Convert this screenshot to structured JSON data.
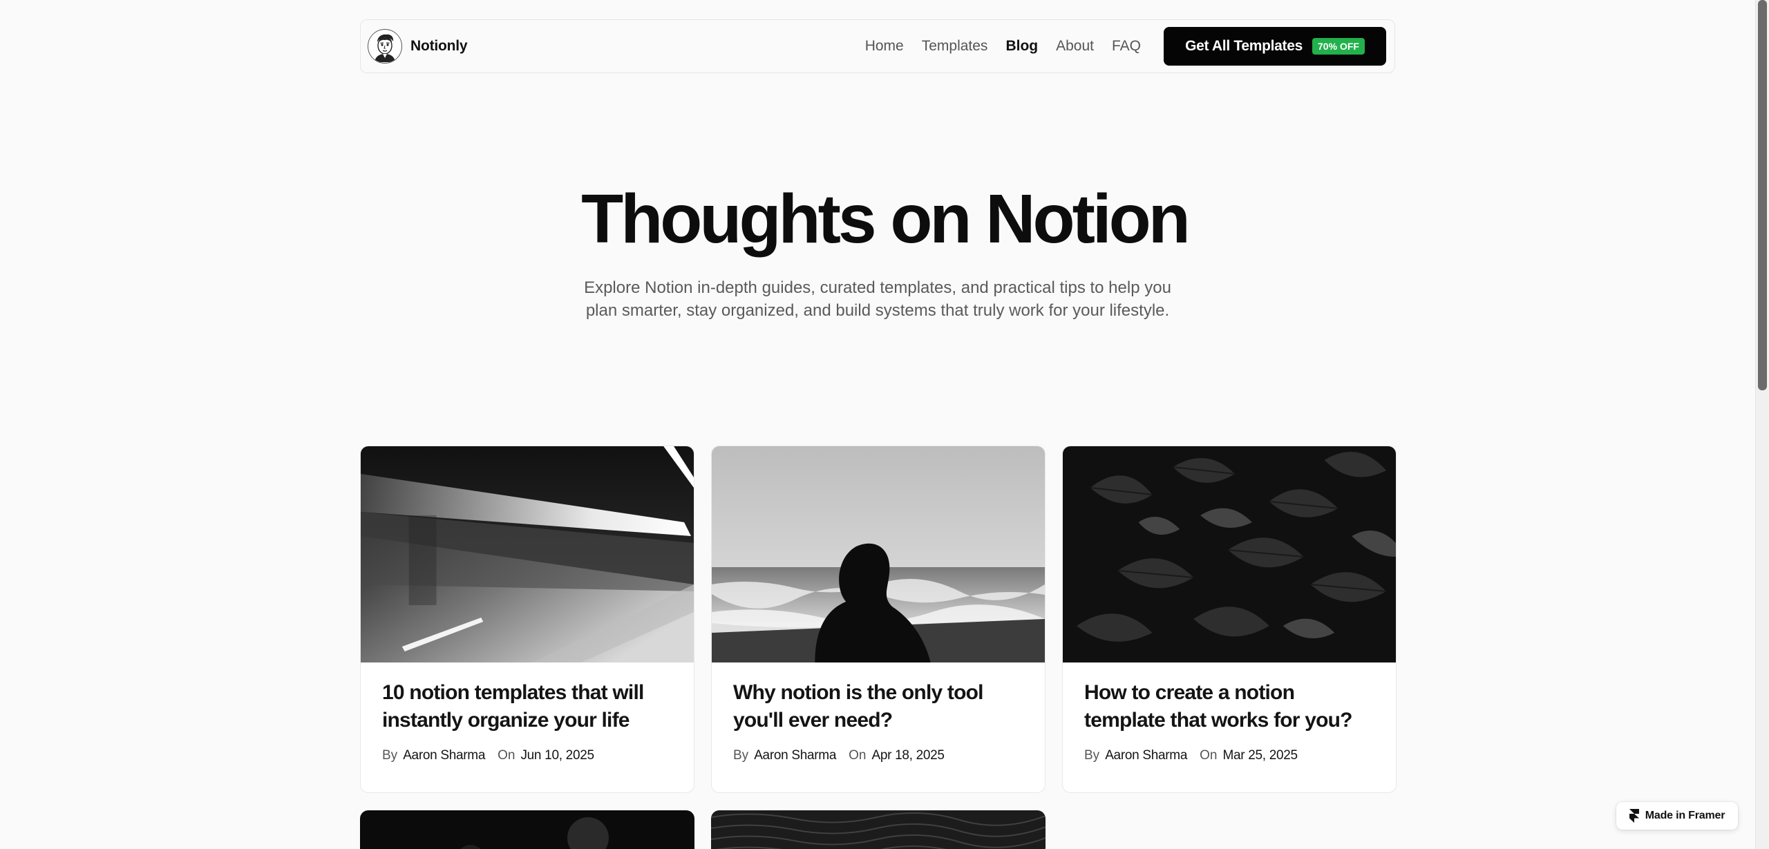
{
  "brand": {
    "name": "Notionly",
    "avatar_icon": "cartoon-face-avatar-icon"
  },
  "nav": {
    "links": [
      {
        "label": "Home",
        "active": false
      },
      {
        "label": "Templates",
        "active": false
      },
      {
        "label": "Blog",
        "active": true
      },
      {
        "label": "About",
        "active": false
      },
      {
        "label": "FAQ",
        "active": false
      }
    ],
    "cta_label": "Get All Templates",
    "cta_badge": "70% OFF"
  },
  "hero": {
    "title": "Thoughts on Notion",
    "subtitle": "Explore Notion in-depth guides, curated templates, and practical tips to help you plan smarter, stay organized, and build systems that truly work for your lifestyle."
  },
  "posts": [
    {
      "title": "10 notion templates that will instantly organize your life",
      "by_label": "By",
      "author": "Aaron Sharma",
      "on_label": "On",
      "date": "Jun 10, 2025",
      "image": "motion-blur-train-photo"
    },
    {
      "title": "Why notion is the only tool you'll ever need?",
      "by_label": "By",
      "author": "Aaron Sharma",
      "on_label": "On",
      "date": "Apr 18, 2025",
      "image": "woman-silhouette-sea-photo"
    },
    {
      "title": "How to create a notion template that works for you?",
      "by_label": "By",
      "author": "Aaron Sharma",
      "on_label": "On",
      "date": "Mar 25, 2025",
      "image": "dark-leaves-photo"
    }
  ],
  "framer_badge": {
    "label": "Made in Framer",
    "icon": "framer-logo-icon"
  },
  "colors": {
    "background": "#fafafa",
    "cta_bg": "#050505",
    "badge_green": "#22b14c",
    "text_primary": "#111111",
    "text_muted": "#555555"
  }
}
